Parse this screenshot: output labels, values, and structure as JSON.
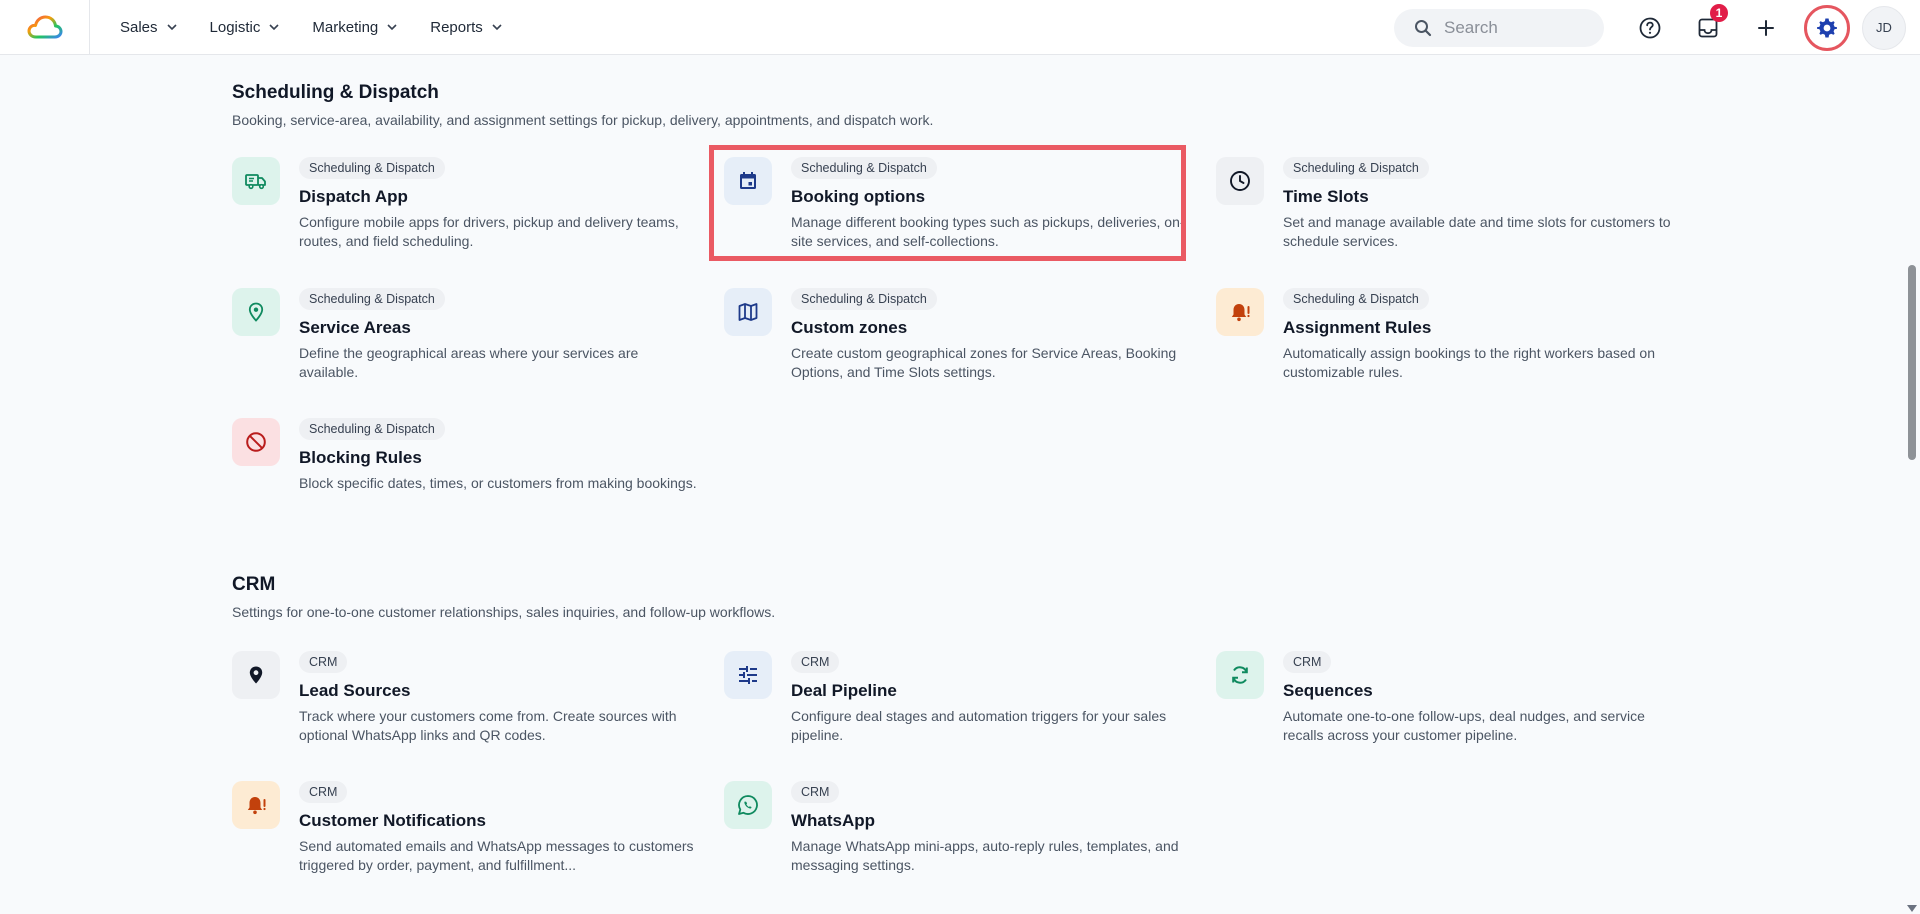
{
  "nav": {
    "items": [
      {
        "label": "Sales"
      },
      {
        "label": "Logistic"
      },
      {
        "label": "Marketing"
      },
      {
        "label": "Reports"
      }
    ]
  },
  "topbar": {
    "search_placeholder": "Search",
    "inbox_badge": "1",
    "avatar_initials": "JD"
  },
  "sections": {
    "scheduling": {
      "title": "Scheduling & Dispatch",
      "description": "Booking, service-area, availability, and assignment settings for pickup, delivery, appointments, and dispatch work.",
      "cards": [
        {
          "tag": "Scheduling & Dispatch",
          "title": "Dispatch App",
          "desc": "Configure mobile apps for drivers, pickup and delivery teams, routes, and field scheduling.",
          "icon": "truck-icon"
        },
        {
          "tag": "Scheduling & Dispatch",
          "title": "Booking options",
          "desc": "Manage different booking types such as pickups, deliveries, on-site services, and self-collections.",
          "icon": "calendar-icon"
        },
        {
          "tag": "Scheduling & Dispatch",
          "title": "Time Slots",
          "desc": "Set and manage available date and time slots for customers to schedule services.",
          "icon": "clock-icon"
        },
        {
          "tag": "Scheduling & Dispatch",
          "title": "Service Areas",
          "desc": "Define the geographical areas where your services are available.",
          "icon": "location-pin-icon"
        },
        {
          "tag": "Scheduling & Dispatch",
          "title": "Custom zones",
          "desc": "Create custom geographical zones for Service Areas, Booking Options, and Time Slots settings.",
          "icon": "map-icon"
        },
        {
          "tag": "Scheduling & Dispatch",
          "title": "Assignment Rules",
          "desc": "Automatically assign bookings to the right workers based on customizable rules.",
          "icon": "bell-alert-icon"
        },
        {
          "tag": "Scheduling & Dispatch",
          "title": "Blocking Rules",
          "desc": "Block specific dates, times, or customers from making bookings.",
          "icon": "block-icon"
        }
      ]
    },
    "crm": {
      "title": "CRM",
      "description": "Settings for one-to-one customer relationships, sales inquiries, and follow-up workflows.",
      "cards": [
        {
          "tag": "CRM",
          "title": "Lead Sources",
          "desc": "Track where your customers come from. Create sources with optional WhatsApp links and QR codes.",
          "icon": "pin-icon"
        },
        {
          "tag": "CRM",
          "title": "Deal Pipeline",
          "desc": "Configure deal stages and automation triggers for your sales pipeline.",
          "icon": "pipeline-icon"
        },
        {
          "tag": "CRM",
          "title": "Sequences",
          "desc": "Automate one-to-one follow-ups, deal nudges, and service recalls across your customer pipeline.",
          "icon": "refresh-icon"
        },
        {
          "tag": "CRM",
          "title": "Customer Notifications",
          "desc": "Send automated emails and WhatsApp messages to customers triggered by order, payment, and fulfillment...",
          "icon": "bell-alert-icon"
        },
        {
          "tag": "CRM",
          "title": "WhatsApp",
          "desc": "Manage WhatsApp mini-apps, auto-reply rules, templates, and messaging settings.",
          "icon": "whatsapp-icon"
        }
      ]
    }
  },
  "colors": {
    "highlight": "#ea5a63",
    "green_icon": "#0f8a5f",
    "blue_icon": "#1e3a8a",
    "orange_icon": "#c2410c",
    "red_icon": "#b91c1c"
  }
}
